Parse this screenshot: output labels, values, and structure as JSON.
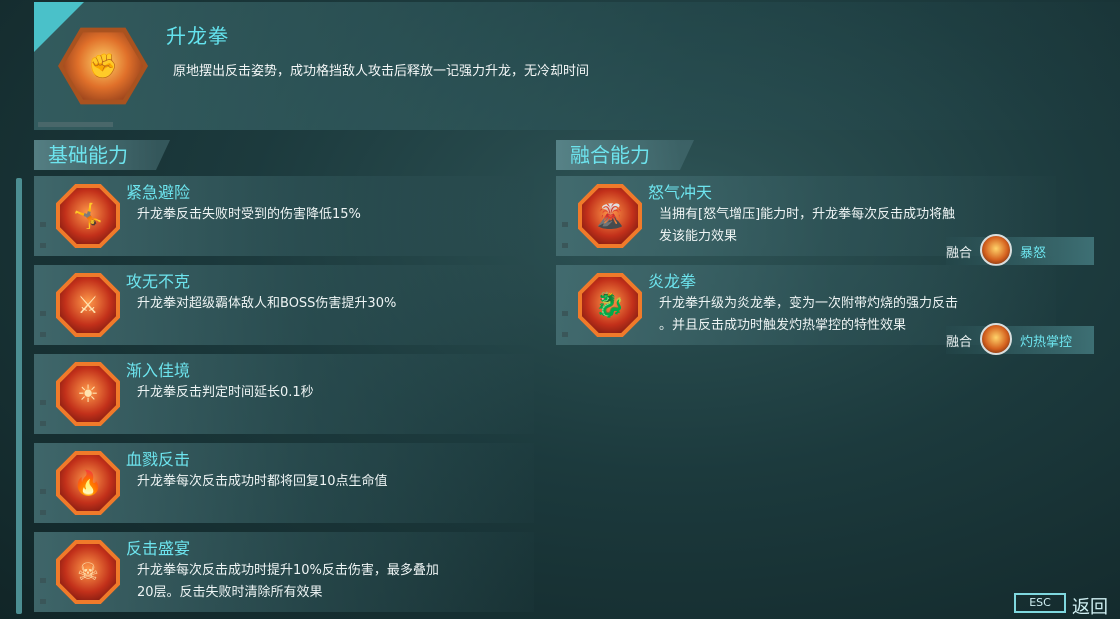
{
  "skill": {
    "title": "升龙拳",
    "description": "原地摆出反击姿势，成功格挡敌人攻击后释放一记强力升龙，无冷却时间",
    "icon": "fist-flame-icon"
  },
  "basic": {
    "title": "基础能力",
    "items": [
      {
        "name": "紧急避险",
        "desc_lines": [
          "升龙拳反击失败时受到的伤害降低15%"
        ],
        "icon": "dodge-figure-icon"
      },
      {
        "name": "攻无不克",
        "desc_lines": [
          "升龙拳对超级霸体敌人和BOSS伤害提升30%"
        ],
        "icon": "claw-strike-icon"
      },
      {
        "name": "渐入佳境",
        "desc_lines": [
          "升龙拳反击判定时间延长0.1秒"
        ],
        "icon": "focus-figure-icon"
      },
      {
        "name": "血戮反击",
        "desc_lines": [
          "升龙拳每次反击成功时都将回复10点生命值"
        ],
        "icon": "blood-claw-icon"
      },
      {
        "name": "反击盛宴",
        "desc_lines": [
          "升龙拳每次反击成功时提升10%反击伤害，最多叠加",
          "20层。反击失败时清除所有效果"
        ],
        "icon": "demon-mask-icon"
      }
    ]
  },
  "fusion": {
    "title": "融合能力",
    "items": [
      {
        "name": "怒气冲天",
        "desc_lines": [
          "当拥有[怒气增压]能力时，升龙拳每次反击成功将触",
          "发该能力效果"
        ],
        "icon": "volcano-icon",
        "tag_label": "融合",
        "tag_name": "暴怒",
        "tag_icon": "rage-icon"
      },
      {
        "name": "炎龙拳",
        "desc_lines": [
          "升龙拳升级为炎龙拳，变为一次附带灼烧的强力反击",
          "。并且反击成功时触发灼热掌控的特性效果"
        ],
        "icon": "flame-dragon-icon",
        "tag_label": "融合",
        "tag_name": "灼热掌控",
        "tag_icon": "burn-icon"
      }
    ]
  },
  "footer": {
    "esc_key": "ESC",
    "back_label": "返回"
  }
}
